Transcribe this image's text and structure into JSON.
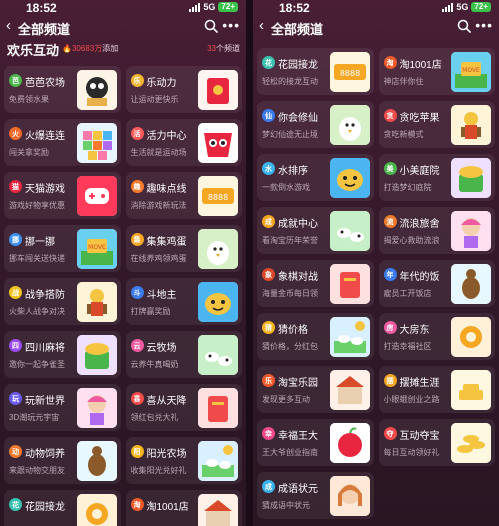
{
  "left": {
    "status": {
      "time": "18:52",
      "network": "5G",
      "battery": "72+"
    },
    "nav": {
      "back_glyph": "‹",
      "title": "全部频道",
      "search_icon": "search-icon",
      "more_icon": "more-icon"
    },
    "section": {
      "title": "欢乐互动",
      "count": "30683万",
      "count_suffix": "添加",
      "total_num": "33",
      "total_suffix": "个频道"
    },
    "cards": [
      {
        "name": "芭芭农场",
        "desc": "免费领水果",
        "icon_color": "#4ab54a",
        "icon_glyph": "芭"
      },
      {
        "name": "乐动力",
        "desc": "让运动更快乐",
        "icon_color": "#f2b531",
        "icon_glyph": "乐"
      },
      {
        "name": "火爆连连",
        "desc": "闯关拿奖励",
        "icon_color": "#f06a2a",
        "icon_glyph": "火"
      },
      {
        "name": "活力中心",
        "desc": "生活就是运动场",
        "icon_color": "#ff5a5a",
        "icon_glyph": "活"
      },
      {
        "name": "天猫游戏",
        "desc": "游戏好物享优惠",
        "icon_color": "#e8263f",
        "icon_glyph": "猫"
      },
      {
        "name": "趣味点线",
        "desc": "消除游戏新玩法",
        "icon_color": "#ff7a2a",
        "icon_glyph": "趣"
      },
      {
        "name": "挪一挪",
        "desc": "挪车闯关送快递",
        "icon_color": "#3d8ff0",
        "icon_glyph": "挪"
      },
      {
        "name": "集集鸡蛋",
        "desc": "在线养鸡领鸡蛋",
        "icon_color": "#f5a623",
        "icon_glyph": "集"
      },
      {
        "name": "战争搭防",
        "desc": "火柴人战争对决",
        "icon_color": "#f2c21b",
        "icon_glyph": "战"
      },
      {
        "name": "斗地主",
        "desc": "打牌赢奖励",
        "icon_color": "#3a7cf0",
        "icon_glyph": "斗"
      },
      {
        "name": "四川麻将",
        "desc": "邀你一起争雀圣",
        "icon_color": "#9a4cf0",
        "icon_glyph": "四"
      },
      {
        "name": "云牧场",
        "desc": "云养牛真喝奶",
        "icon_color": "#f05aa0",
        "icon_glyph": "云"
      },
      {
        "name": "玩新世界",
        "desc": "3D潮玩元宇宙",
        "icon_color": "#6a5af0",
        "icon_glyph": "玩"
      },
      {
        "name": "喜从天降",
        "desc": "领红包兑大礼",
        "icon_color": "#f04a4a",
        "icon_glyph": "喜"
      },
      {
        "name": "动物饲养",
        "desc": "来跟动物交朋友",
        "icon_color": "#f07a2a",
        "icon_glyph": "动"
      },
      {
        "name": "阳光农场",
        "desc": "收集阳光兑好礼",
        "icon_color": "#f5b51b",
        "icon_glyph": "阳"
      },
      {
        "name": "花园接龙",
        "desc": "",
        "icon_color": "#3ac2b0",
        "icon_glyph": "花"
      },
      {
        "name": "淘1001店",
        "desc": "",
        "icon_color": "#f05a2a",
        "icon_glyph": "淘"
      }
    ]
  },
  "right": {
    "status": {
      "time": "18:52",
      "network": "5G",
      "battery": "72+"
    },
    "nav": {
      "back_glyph": "‹",
      "title": "全部频道",
      "search_icon": "search-icon",
      "more_icon": "more-icon"
    },
    "cards": [
      {
        "name": "花园接龙",
        "desc": "轻松的接龙互动",
        "icon_color": "#3ac2b0",
        "icon_glyph": "花"
      },
      {
        "name": "淘1001店",
        "desc": "神店伴你住",
        "icon_color": "#f05a2a",
        "icon_glyph": "淘"
      },
      {
        "name": "你会修仙",
        "desc": "梦幻仙途无止境",
        "icon_color": "#3a7cf0",
        "icon_glyph": "仙"
      },
      {
        "name": "贪吃苹果",
        "desc": "贪吃新模式",
        "icon_color": "#f04a4a",
        "icon_glyph": "贪"
      },
      {
        "name": "水排序",
        "desc": "一款倒水游戏",
        "icon_color": "#3ab4f0",
        "icon_glyph": "水"
      },
      {
        "name": "小美庭院",
        "desc": "打造梦幻庭院",
        "icon_color": "#4ab54a",
        "icon_glyph": "美"
      },
      {
        "name": "成就中心",
        "desc": "看淘宝历年荣誉",
        "icon_color": "#f5a623",
        "icon_glyph": "成"
      },
      {
        "name": "流浪旅舍",
        "desc": "揭爱心救助流浪",
        "icon_color": "#f07a2a",
        "icon_glyph": "流"
      },
      {
        "name": "象棋对战",
        "desc": "海量金币每日领",
        "icon_color": "#d84a2a",
        "icon_glyph": "象"
      },
      {
        "name": "年代的饭",
        "desc": "雇员工开饭店",
        "icon_color": "#3a7cf0",
        "icon_glyph": "年"
      },
      {
        "name": "猜价格",
        "desc": "猜价格，分红包",
        "icon_color": "#f5b51b",
        "icon_glyph": "猜"
      },
      {
        "name": "大房东",
        "desc": "打造幸福社区",
        "icon_color": "#f05aa0",
        "icon_glyph": "房"
      },
      {
        "name": "淘宝乐园",
        "desc": "发现更多互动",
        "icon_color": "#f05a2a",
        "icon_glyph": "乐"
      },
      {
        "name": "摆摊生涯",
        "desc": "小眼蛾创业之路",
        "icon_color": "#f5a623",
        "icon_glyph": "摆"
      },
      {
        "name": "幸福王大",
        "desc": "王大爷创业指南",
        "icon_color": "#f04a8a",
        "icon_glyph": "幸"
      },
      {
        "name": "互动夺宝",
        "desc": "每日互动领好礼",
        "icon_color": "#f04a4a",
        "icon_glyph": "夺"
      },
      {
        "name": "成语状元",
        "desc": "猜成语中状元",
        "icon_color": "#3ab4f0",
        "icon_glyph": "成"
      }
    ]
  }
}
